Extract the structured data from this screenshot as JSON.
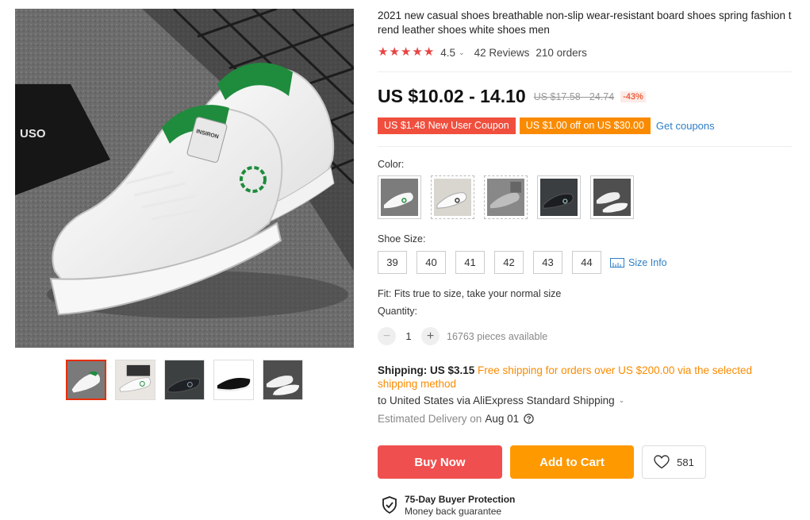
{
  "product": {
    "title": "2021 new casual shoes breathable non-slip wear-resistant board shoes spring fashion trend leather shoes white shoes men",
    "rating": "4.5",
    "reviews": "42 Reviews",
    "orders": "210 orders",
    "star_count": 5,
    "price": "US $10.02 - 14.10",
    "original_price": "US $17.58 - 24.74",
    "discount": "-43%"
  },
  "coupons": {
    "new_user": "US $1.48 New User Coupon",
    "store": "US $1.00 off on US $30.00",
    "get_coupons": "Get coupons"
  },
  "options": {
    "color_label": "Color:",
    "size_label": "Shoe Size:",
    "sizes": [
      "39",
      "40",
      "41",
      "42",
      "43",
      "44"
    ],
    "size_info": "Size Info",
    "fit_text": "Fit: Fits true to size, take your normal size",
    "quantity_label": "Quantity:",
    "quantity": "1",
    "available": "16763 pieces available"
  },
  "shipping": {
    "label": "Shipping: US $3.15",
    "free_note": "Free shipping for orders over US $200.00 via the selected shipping method",
    "destination": "to United States via AliExpress Standard Shipping",
    "delivery_label": "Estimated Delivery on",
    "delivery_date": "Aug 01"
  },
  "actions": {
    "buy_now": "Buy Now",
    "add_to_cart": "Add to Cart",
    "wishlist_count": "581"
  },
  "protection": {
    "title": "75-Day Buyer Protection",
    "subtitle": "Money back guarantee"
  },
  "image_text": {
    "logo_text": "USO",
    "tongue_label": "INSIRON"
  },
  "colors": {
    "accent_red": "#f04f4f",
    "accent_orange": "#ff9900",
    "link_blue": "#2e7fc6",
    "star_red": "#e84343",
    "shoe_green": "#1e8c3c"
  }
}
